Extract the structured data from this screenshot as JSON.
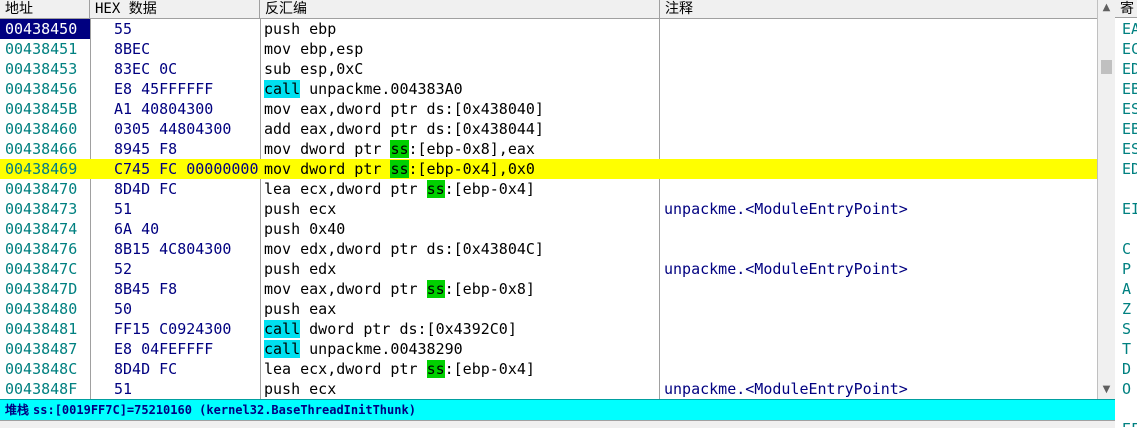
{
  "columns": {
    "addr": "地址",
    "hex": "HEX 数据",
    "disasm": "反汇编",
    "comment": "注释",
    "reg": "寄"
  },
  "rows": [
    {
      "addr": "00438450",
      "hex": "55",
      "dis": [
        {
          "t": "push ebp"
        }
      ],
      "comment": ""
    },
    {
      "addr": "00438451",
      "hex": "8BEC",
      "dis": [
        {
          "t": "mov ebp,esp"
        }
      ],
      "comment": ""
    },
    {
      "addr": "00438453",
      "hex": "83EC 0C",
      "dis": [
        {
          "t": "sub esp,0xC"
        }
      ],
      "comment": ""
    },
    {
      "addr": "00438456",
      "hex": "E8 45FFFFFF",
      "dis": [
        {
          "t": "call",
          "k": "call"
        },
        {
          "t": " unpackme.004383A0"
        }
      ],
      "comment": ""
    },
    {
      "addr": "0043845B",
      "hex": "A1 40804300",
      "dis": [
        {
          "t": "mov eax,dword ptr ds:[0x438040]"
        }
      ],
      "comment": ""
    },
    {
      "addr": "00438460",
      "hex": "0305 44804300",
      "dis": [
        {
          "t": "add eax,dword ptr ds:[0x438044]"
        }
      ],
      "comment": ""
    },
    {
      "addr": "00438466",
      "hex": "8945 F8",
      "dis": [
        {
          "t": "mov dword ptr "
        },
        {
          "t": "ss",
          "k": "ss"
        },
        {
          "t": ":[ebp-0x8],eax"
        }
      ],
      "comment": ""
    },
    {
      "addr": "00438469",
      "hex": "C745 FC 00000000",
      "dis": [
        {
          "t": "mov dword ptr "
        },
        {
          "t": "ss",
          "k": "ss"
        },
        {
          "t": ":[ebp-0x4],0x0"
        }
      ],
      "comment": ""
    },
    {
      "addr": "00438470",
      "hex": "8D4D FC",
      "dis": [
        {
          "t": "lea ecx,dword ptr "
        },
        {
          "t": "ss",
          "k": "ss"
        },
        {
          "t": ":[ebp-0x4]"
        }
      ],
      "comment": ""
    },
    {
      "addr": "00438473",
      "hex": "51",
      "dis": [
        {
          "t": "push ecx"
        }
      ],
      "comment": "unpackme.<ModuleEntryPoint>"
    },
    {
      "addr": "00438474",
      "hex": "6A 40",
      "dis": [
        {
          "t": "push 0x40"
        }
      ],
      "comment": ""
    },
    {
      "addr": "00438476",
      "hex": "8B15 4C804300",
      "dis": [
        {
          "t": "mov edx,dword ptr ds:[0x43804C]"
        }
      ],
      "comment": ""
    },
    {
      "addr": "0043847C",
      "hex": "52",
      "dis": [
        {
          "t": "push edx"
        }
      ],
      "comment": "unpackme.<ModuleEntryPoint>"
    },
    {
      "addr": "0043847D",
      "hex": "8B45 F8",
      "dis": [
        {
          "t": "mov eax,dword ptr "
        },
        {
          "t": "ss",
          "k": "ss"
        },
        {
          "t": ":[ebp-0x8]"
        }
      ],
      "comment": ""
    },
    {
      "addr": "00438480",
      "hex": "50",
      "dis": [
        {
          "t": "push eax"
        }
      ],
      "comment": ""
    },
    {
      "addr": "00438481",
      "hex": "FF15 C0924300",
      "dis": [
        {
          "t": "call",
          "k": "call"
        },
        {
          "t": " dword ptr ds:[0x4392C0]"
        }
      ],
      "comment": ""
    },
    {
      "addr": "00438487",
      "hex": "E8 04FEFFFF",
      "dis": [
        {
          "t": "call",
          "k": "call"
        },
        {
          "t": " unpackme.00438290"
        }
      ],
      "comment": ""
    },
    {
      "addr": "0043848C",
      "hex": "8D4D FC",
      "dis": [
        {
          "t": "lea ecx,dword ptr "
        },
        {
          "t": "ss",
          "k": "ss"
        },
        {
          "t": ":[ebp-0x4]"
        }
      ],
      "comment": ""
    },
    {
      "addr": "0043848F",
      "hex": "51",
      "dis": [
        {
          "t": "push ecx"
        }
      ],
      "comment": "unpackme.<ModuleEntryPoint>"
    }
  ],
  "selected_row": 0,
  "highlighted_row": 7,
  "registers": [
    "EA",
    "EC",
    "ED",
    "EB",
    "ES",
    "EB",
    "ES",
    "ED",
    "",
    "EI",
    "",
    "C",
    "P",
    "A",
    "Z",
    "S",
    "T",
    "D",
    "O",
    "",
    "EF"
  ],
  "status": {
    "label": "堆栈",
    "text": "ss:[0019FF7C]=75210160 (kernel32.BaseThreadInitThunk)"
  },
  "scrollbar": {
    "up": "▲",
    "down": "▼"
  },
  "colors": {
    "call_highlight": "#00e0f0",
    "segment_highlight": "#00d000",
    "row_highlight": "#ffff00",
    "status_bg": "#00ffff",
    "selection": "#000080"
  }
}
